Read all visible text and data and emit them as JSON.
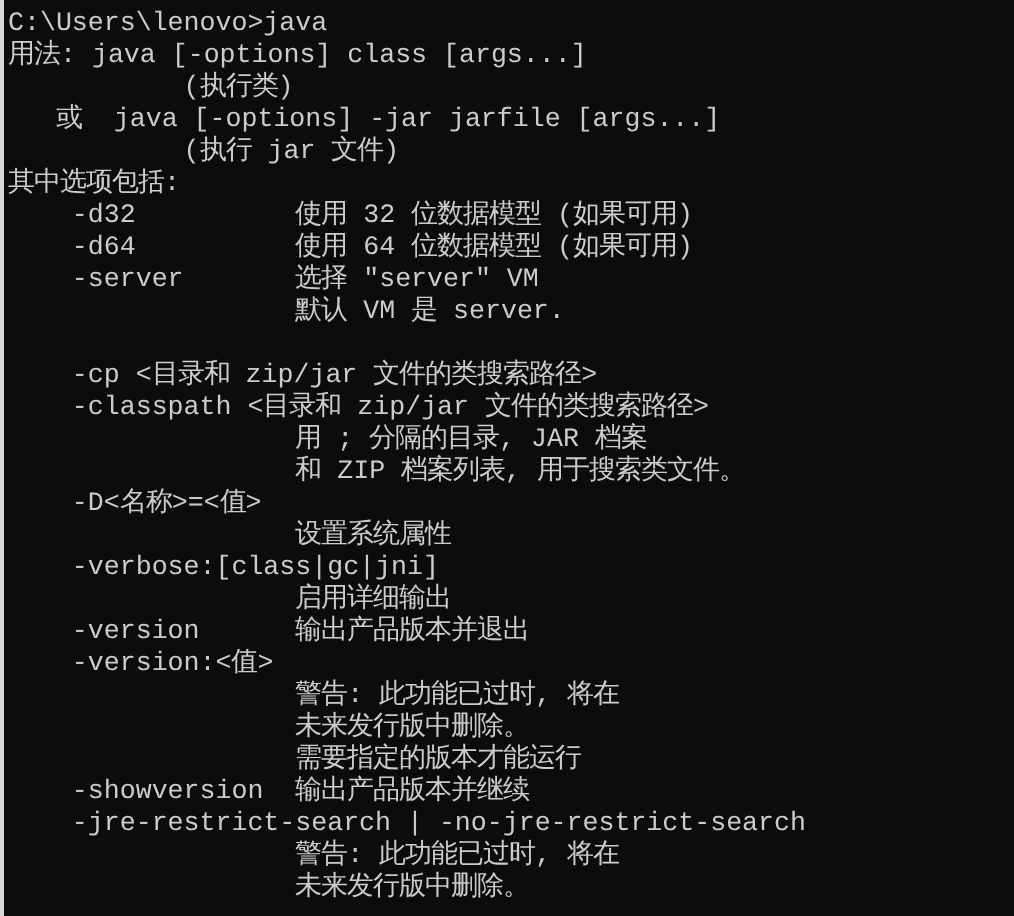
{
  "console": {
    "lines": [
      {
        "kind": "text",
        "text": "C:\\Users\\lenovo>java"
      },
      {
        "kind": "text",
        "text": "用法: java [-options] class [args...]"
      },
      {
        "kind": "text",
        "text": "           (执行类)"
      },
      {
        "kind": "text",
        "text": "   或  java [-options] -jar jarfile [args...]"
      },
      {
        "kind": "text",
        "text": "           (执行 jar 文件)"
      },
      {
        "kind": "text",
        "text": "其中选项包括:"
      },
      {
        "kind": "text",
        "text": "    -d32          使用 32 位数据模型 (如果可用)"
      },
      {
        "kind": "text",
        "text": "    -d64          使用 64 位数据模型 (如果可用)"
      },
      {
        "kind": "text",
        "text": "    -server       选择 \"server\" VM"
      },
      {
        "kind": "text",
        "text": "                  默认 VM 是 server."
      },
      {
        "kind": "blank"
      },
      {
        "kind": "text",
        "text": "    -cp <目录和 zip/jar 文件的类搜索路径>"
      },
      {
        "kind": "text",
        "text": "    -classpath <目录和 zip/jar 文件的类搜索路径>"
      },
      {
        "kind": "text",
        "text": "                  用 ; 分隔的目录, JAR 档案"
      },
      {
        "kind": "text",
        "text": "                  和 ZIP 档案列表, 用于搜索类文件。"
      },
      {
        "kind": "text",
        "text": "    -D<名称>=<值>"
      },
      {
        "kind": "text",
        "text": "                  设置系统属性"
      },
      {
        "kind": "text",
        "text": "    -verbose:[class|gc|jni]"
      },
      {
        "kind": "text",
        "text": "                  启用详细输出"
      },
      {
        "kind": "text",
        "text": "    -version      输出产品版本并退出"
      },
      {
        "kind": "text",
        "text": "    -version:<值>"
      },
      {
        "kind": "text",
        "text": "                  警告: 此功能已过时, 将在"
      },
      {
        "kind": "text",
        "text": "                  未来发行版中删除。"
      },
      {
        "kind": "text",
        "text": "                  需要指定的版本才能运行"
      },
      {
        "kind": "text",
        "text": "    -showversion  输出产品版本并继续"
      },
      {
        "kind": "text",
        "text": "    -jre-restrict-search | -no-jre-restrict-search"
      },
      {
        "kind": "text",
        "text": "                  警告: 此功能已过时, 将在"
      },
      {
        "kind": "text",
        "text": "                  未来发行版中删除。"
      }
    ]
  }
}
